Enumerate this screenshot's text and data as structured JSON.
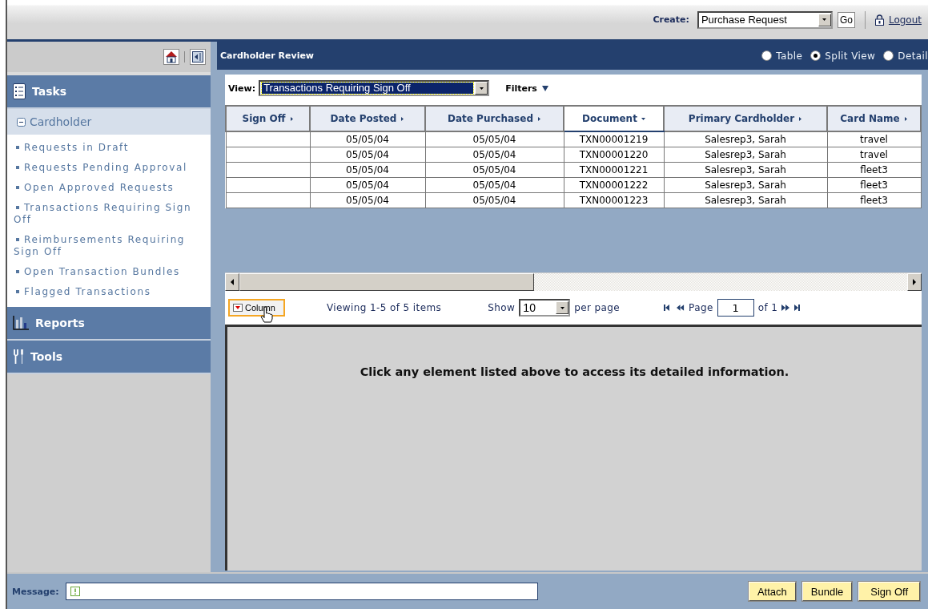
{
  "top_bar": {
    "create_label": "Create:",
    "create_value": "Purchase Request",
    "go_button": "Go",
    "logout_link": "Logout"
  },
  "sidebar": {
    "sections": [
      {
        "kind": "tasks",
        "title": "Tasks",
        "expanded": true,
        "groups": [
          {
            "title": "Cardholder",
            "expanded": true,
            "items": [
              "Requests in Draft",
              "Requests Pending Approval",
              "Open Approved Requests",
              "Transactions Requiring Sign Off",
              "Reimbursements Requiring Sign Off",
              "Open Transaction Bundles",
              "Flagged Transactions"
            ]
          }
        ]
      },
      {
        "kind": "reports",
        "title": "Reports"
      },
      {
        "kind": "tools",
        "title": "Tools"
      }
    ]
  },
  "panel": {
    "title": "Cardholder Review",
    "view_modes": [
      {
        "label": "Table",
        "selected": false
      },
      {
        "label": "Split View",
        "selected": true
      },
      {
        "label": "Detail",
        "selected": false
      }
    ]
  },
  "view": {
    "label": "View:",
    "value": "Transactions Requiring Sign Off",
    "filters_label": "Filters"
  },
  "table": {
    "columns": [
      {
        "label": "Sign Off",
        "sorted": false
      },
      {
        "label": "Date Posted",
        "sorted": false
      },
      {
        "label": "Date Purchased",
        "sorted": false
      },
      {
        "label": "Document",
        "sorted": true
      },
      {
        "label": "Primary Cardholder",
        "sorted": false
      },
      {
        "label": "Card Name",
        "sorted": false
      }
    ],
    "rows": [
      {
        "cells": [
          "",
          "05/05/04",
          "05/05/04",
          "TXN00001219",
          "Salesrep3, Sarah",
          "travel"
        ]
      },
      {
        "cells": [
          "",
          "05/05/04",
          "05/05/04",
          "TXN00001220",
          "Salesrep3, Sarah",
          "travel"
        ]
      },
      {
        "cells": [
          "",
          "05/05/04",
          "05/05/04",
          "TXN00001221",
          "Salesrep3, Sarah",
          "fleet3"
        ]
      },
      {
        "cells": [
          "",
          "05/05/04",
          "05/05/04",
          "TXN00001222",
          "Salesrep3, Sarah",
          "fleet3"
        ]
      },
      {
        "cells": [
          "",
          "05/05/04",
          "05/05/04",
          "TXN00001223",
          "Salesrep3, Sarah",
          "fleet3"
        ]
      }
    ]
  },
  "pager": {
    "column_button": "Column",
    "viewing": "Viewing 1-5 of 5 items",
    "show_label": "Show",
    "page_size": "10",
    "per_page_label": "per page",
    "page_label": "Page",
    "page": "1",
    "of_label": "of 1"
  },
  "detail": {
    "message": "Click any element listed above to access its detailed information."
  },
  "message_bar": {
    "label": "Message:",
    "buttons": [
      "Attach",
      "Bundle",
      "Sign Off"
    ]
  }
}
